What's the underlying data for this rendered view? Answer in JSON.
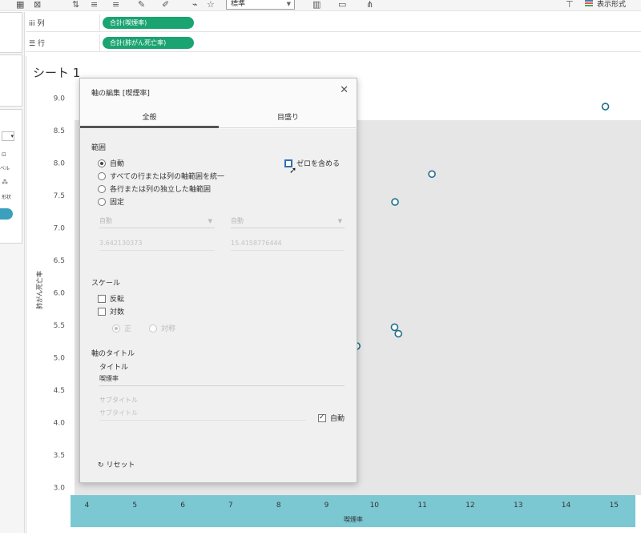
{
  "toolbar": {
    "fit_value": "標準",
    "show_me_label": "表示形式"
  },
  "left_panel": {
    "label_a": "ベル",
    "label_b": "形状"
  },
  "shelves": {
    "columns": {
      "icon": "columns-icon",
      "label": "列",
      "pill": "合計(喫煙率)"
    },
    "rows": {
      "icon": "rows-icon",
      "label": "行",
      "pill": "合計(肺がん死亡率)"
    }
  },
  "sheet": {
    "title": "シート 1"
  },
  "dialog": {
    "title": "軸の編集 [喫煙率]",
    "tabs": [
      "全般",
      "目盛り"
    ],
    "range": {
      "heading": "範囲",
      "options": [
        "自動",
        "すべての行または列の軸範囲を統一",
        "各行または列の独立した軸範囲",
        "固定"
      ],
      "selected": 0,
      "include_zero_label": "ゼロを含める",
      "start_dropdown": "自動",
      "end_dropdown": "自動",
      "start_value": "3.642130373",
      "end_value": "15.4158776444"
    },
    "scale": {
      "heading": "スケール",
      "reversed_label": "反転",
      "log_label": "対数",
      "positive_label": "正",
      "symmetric_label": "対称"
    },
    "axis_title": {
      "heading": "軸のタイトル",
      "title_label": "タイトル",
      "title_value": "喫煙率",
      "subtitle_label": "サブタイトル",
      "subtitle_placeholder": "サブタイトル",
      "auto_label": "自動"
    },
    "reset_label": "リセット"
  },
  "chart_data": {
    "type": "scatter",
    "xlabel": "喫煙率",
    "ylabel": "肺がん死亡率",
    "xlim": [
      3.6,
      15.4
    ],
    "ylim": [
      3.0,
      9.0
    ],
    "x_ticks": [
      "4",
      "5",
      "6",
      "7",
      "8",
      "9",
      "10",
      "11",
      "12",
      "13",
      "14",
      "15"
    ],
    "y_ticks": [
      "9.0",
      "8.5",
      "8.0",
      "7.5",
      "7.0",
      "6.5",
      "6.0",
      "5.5",
      "5.0",
      "4.5",
      "4.0",
      "3.5",
      "3.0"
    ],
    "points": [
      {
        "x": 14.82,
        "y": 8.87
      },
      {
        "x": 11.2,
        "y": 7.83
      },
      {
        "x": 10.43,
        "y": 7.4
      },
      {
        "x": 10.42,
        "y": 5.47
      },
      {
        "x": 10.5,
        "y": 5.37
      },
      {
        "x": 9.63,
        "y": 5.18
      }
    ],
    "grid": false,
    "colors": {
      "point_stroke": "#1f6e8c",
      "axis_band": "#7bc8d3",
      "plot_bg": "#e6e6e6"
    }
  }
}
